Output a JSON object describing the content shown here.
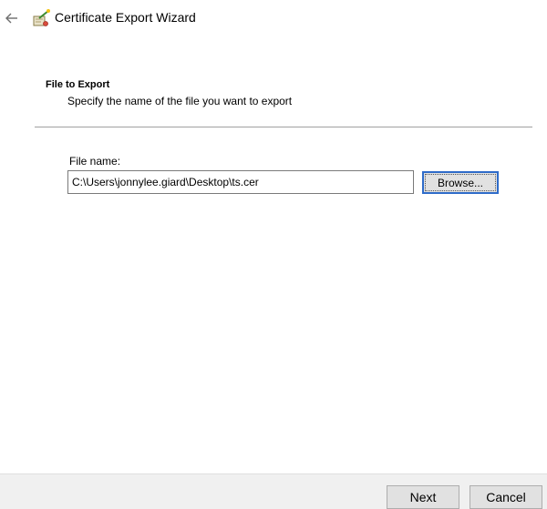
{
  "window": {
    "title": "Certificate Export Wizard"
  },
  "header": {
    "section_title": "File to Export",
    "section_subtitle": "Specify the name of the file you want to export"
  },
  "form": {
    "file_name_label": "File name:",
    "file_name_value": "C:\\Users\\jonnylee.giard\\Desktop\\ts.cer",
    "browse_label": "Browse..."
  },
  "footer": {
    "next_label": "Next",
    "cancel_label": "Cancel"
  },
  "icons": {
    "back": "back-arrow-icon",
    "wizard": "certificate-wizard-icon"
  },
  "colors": {
    "focus_border": "#2e6bc9",
    "button_face": "#e1e1e1",
    "footer_bg": "#f0f0f0",
    "divider": "#a0a0a0"
  }
}
